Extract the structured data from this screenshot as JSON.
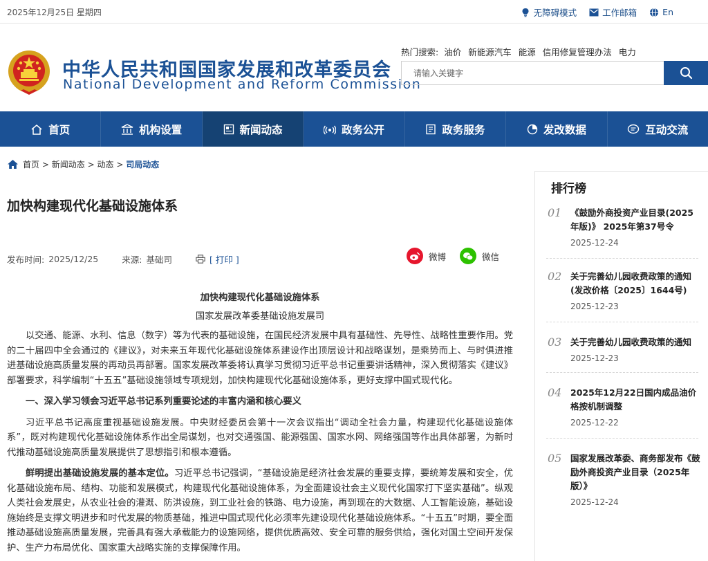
{
  "topbar": {
    "date": "2025年12月25日 星期四",
    "links": [
      {
        "label": "无障碍模式",
        "icon": "accessibility-icon"
      },
      {
        "label": "工作邮箱",
        "icon": "mail-icon"
      },
      {
        "label": "En",
        "icon": "globe-icon"
      }
    ]
  },
  "header": {
    "title_cn": "中华人民共和国国家发展和改革委员会",
    "title_en": "National Development and Reform Commission",
    "hot_label": "热门搜索:",
    "hot_keywords": [
      "油价",
      "新能源汽车",
      "能源",
      "信用修复管理办法",
      "电力"
    ],
    "search_placeholder": "请输入关键字"
  },
  "nav": [
    {
      "label": "首页",
      "icon": "home-icon",
      "active": false
    },
    {
      "label": "机构设置",
      "icon": "institution-icon",
      "active": false
    },
    {
      "label": "新闻动态",
      "icon": "news-icon",
      "active": true
    },
    {
      "label": "政务公开",
      "icon": "broadcast-icon",
      "active": false
    },
    {
      "label": "政务服务",
      "icon": "service-icon",
      "active": false
    },
    {
      "label": "发改数据",
      "icon": "data-pie-icon",
      "active": false
    },
    {
      "label": "互动交流",
      "icon": "chat-icon",
      "active": false
    }
  ],
  "breadcrumb": {
    "items": [
      "首页",
      "新闻动态",
      "动态"
    ],
    "current": "司局动态",
    "separator": ">"
  },
  "article": {
    "title": "加快构建现代化基础设施体系",
    "publish_label": "发布时间:",
    "publish_date": "2025/12/25",
    "source_label": "来源:",
    "source": "基础司",
    "print_label": "[ 打印 ]",
    "share": [
      {
        "label": "微博",
        "icon": "weibo-icon",
        "color": "#e6162d"
      },
      {
        "label": "微信",
        "icon": "wechat-icon",
        "color": "#2dc100"
      }
    ],
    "heading": "加快构建现代化基础设施体系",
    "author": "国家发展改革委基础设施发展司",
    "p1": "以交通、能源、水利、信息（数字）等为代表的基础设施，在国民经济发展中具有基础性、先导性、战略性重要作用。党的二十届四中全会通过的《建议》，对未来五年现代化基础设施体系建设作出顶层设计和战略谋划，是乘势而上、与时俱进推进基础设施高质量发展的再动员再部署。国家发展改革委将认真学习贯彻习近平总书记重要讲话精神，深入贯彻落实《建议》部署要求，科学编制“十五五”基础设施领域专项规划，加快构建现代化基础设施体系，更好支撑中国式现代化。",
    "section1": "一、深入学习领会习近平总书记系列重要论述的丰富内涵和核心要义",
    "p2": "习近平总书记高度重视基础设施发展。中央财经委员会第十一次会议指出“调动全社会力量，构建现代化基础设施体系”，既对构建现代化基础设施体系作出全局谋划，也对交通强国、能源强国、国家水网、网络强国等作出具体部署，为新时代推动基础设施高质量发展提供了思想指引和根本遵循。",
    "p3_bold": "鲜明提出基础设施发展的基本定位。",
    "p3": "习近平总书记强调，“基础设施是经济社会发展的重要支撑，要统筹发展和安全，优化基础设施布局、结构、功能和发展模式，构建现代化基础设施体系，为全面建设社会主义现代化国家打下坚实基础”。纵观人类社会发展史，从农业社会的灌溉、防洪设施，到工业社会的铁路、电力设施，再到现在的大数据、人工智能设施，基础设施始终是支撑文明进步和时代发展的物质基础，推进中国式现代化必须率先建设现代化基础设施体系。“十五五”时期，要全面推动基础设施高质量发展，完善具有强大承载能力的设施网络，提供优质高效、安全可靠的服务供给，强化对国土空间开发保护、生产力布局优化、国家重大战略实施的支撑保障作用。"
  },
  "sidebar": {
    "title": "排行榜",
    "items": [
      {
        "num": "01",
        "title": "《鼓励外商投资产业目录(2025年版)》 2025年第37号令",
        "date": "2025-12-24"
      },
      {
        "num": "02",
        "title": "关于完善幼儿园收费政策的通知(发改价格〔2025〕1644号)",
        "date": "2025-12-23"
      },
      {
        "num": "03",
        "title": "关于完善幼儿园收费政策的通知",
        "date": "2025-12-23"
      },
      {
        "num": "04",
        "title": "2025年12月22日国内成品油价格按机制调整",
        "date": "2025-12-22"
      },
      {
        "num": "05",
        "title": "国家发展改革委、商务部发布《鼓励外商投资产业目录（2025年版）》",
        "date": "2025-12-24"
      }
    ]
  },
  "colors": {
    "brand": "#1b5195",
    "nav_active": "#154273"
  }
}
